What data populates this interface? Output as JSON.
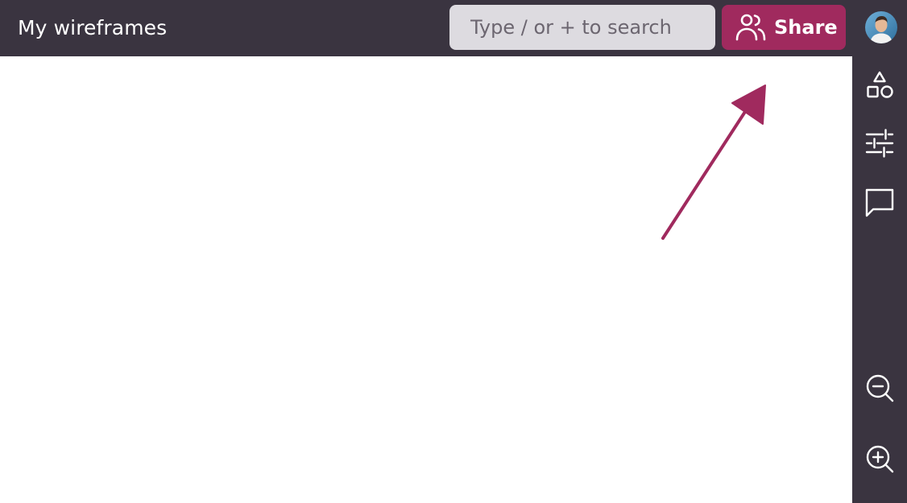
{
  "header": {
    "title": "My wireframes",
    "search_placeholder": "Type / or + to search",
    "share_label": "Share",
    "share_icon": "users-icon"
  },
  "sidebar": {
    "tools": [
      {
        "name": "shapes-icon"
      },
      {
        "name": "sliders-icon"
      },
      {
        "name": "comment-icon"
      },
      {
        "name": "zoom-out-icon"
      },
      {
        "name": "zoom-in-icon"
      }
    ]
  },
  "canvas": {
    "annotation": "arrow pointing to share button"
  },
  "colors": {
    "topbar": "#3a3440",
    "accent": "#a02a5e",
    "search_bg": "#dddbe0",
    "canvas": "#ffffff"
  }
}
